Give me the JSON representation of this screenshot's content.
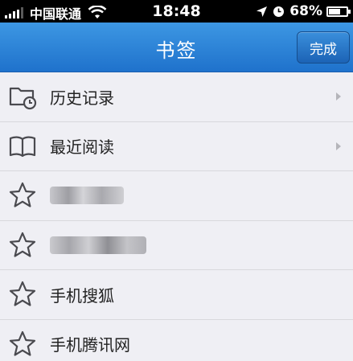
{
  "status_bar": {
    "carrier": "中国联通",
    "time": "18:48",
    "battery_percent": "68%",
    "battery_level": 0.68
  },
  "nav_bar": {
    "title": "书签",
    "done_label": "完成"
  },
  "list": {
    "items": [
      {
        "label": "历史记录",
        "icon": "history-folder-icon",
        "has_chevron": true
      },
      {
        "label": "最近阅读",
        "icon": "book-icon",
        "has_chevron": true
      },
      {
        "label": "",
        "icon": "star-icon",
        "redacted": true
      },
      {
        "label": "",
        "icon": "star-icon",
        "redacted": true
      },
      {
        "label": "手机搜狐",
        "icon": "star-icon"
      },
      {
        "label": "手机腾讯网",
        "icon": "star-icon"
      }
    ]
  },
  "colors": {
    "nav_top": "#3d97e3",
    "nav_bottom": "#1f72cc",
    "background": "#efeff4"
  }
}
